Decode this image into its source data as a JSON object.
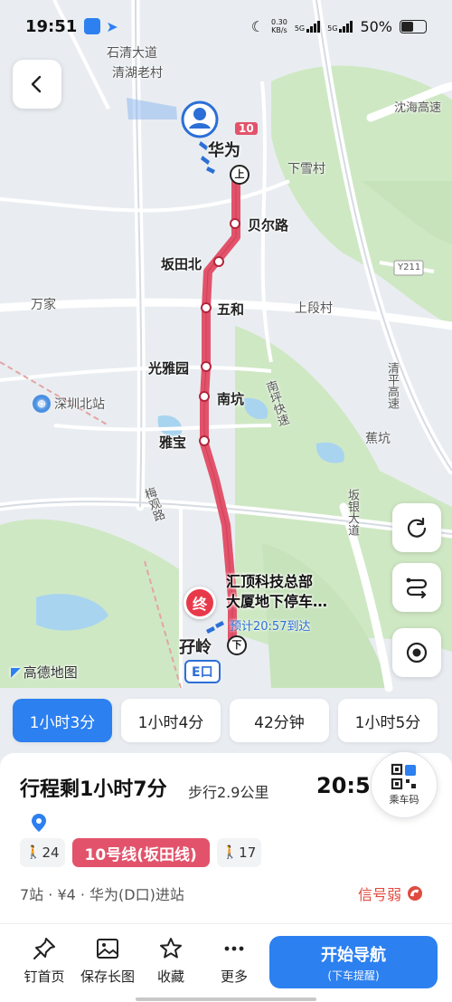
{
  "status_bar": {
    "time": "19:51",
    "network_speed_value": "0.30",
    "network_speed_unit": "KB/s",
    "sim1": "5G",
    "sim2": "5G",
    "battery": "50%",
    "battery_level": 0.5
  },
  "map": {
    "labels": {
      "shi_qing_avenue": "石清大道",
      "qinghu_old_village": "清湖老村",
      "shenhai_expressway": "沈海高速",
      "xiaxuecun": "下雪村",
      "wanjia": "万家",
      "shangduancun": "上段村",
      "shenzhen_north": "深圳北站",
      "nanping_expressway": "南坪快速",
      "qingping_expressway": "清平高速",
      "jiaokeng": "蕉坑",
      "meiguan_road": "梅观路",
      "bantian_avenue": "坂银大道",
      "y211": "Y211"
    },
    "line_badge": "10",
    "stations": {
      "huawei": "华为",
      "beier_road": "贝尔路",
      "bantian_north": "坂田北",
      "wuhe": "五和",
      "guangyayuan": "光雅园",
      "nankeng": "南坑",
      "yabao": "雅宝",
      "yaling": "孖岭"
    },
    "board_marker": "上",
    "alight_marker": "下",
    "destination_marker": "终",
    "destination_name_line1": "汇顶科技总部",
    "destination_name_line2": "大厦地下停车…",
    "eta": "预计20:57到达",
    "exit_badge": "E口",
    "logo_text": "高德地图"
  },
  "route_tabs": [
    "1小时3分",
    "1小时4分",
    "42分钟",
    "1小时5分"
  ],
  "sheet": {
    "trip_summary": "行程剩1小时7分",
    "walk_distance": "步行2.9公里",
    "arrive_time": "20:57",
    "ride_code_label": "乘车码",
    "walk_before": "24",
    "line_name": "10号线(坂田线)",
    "walk_after": "17",
    "trip_meta": "7站 · ¥4 · 华为(D口)进站",
    "signal_text": "信号弱",
    "line_color": "#e2536b",
    "accent_color": "#2c80f0"
  },
  "actions": {
    "pin_home": "钉首页",
    "save_image": "保存长图",
    "favorite": "收藏",
    "more": "更多",
    "start_nav": "开始导航",
    "start_nav_sub": "(下车提醒)"
  }
}
